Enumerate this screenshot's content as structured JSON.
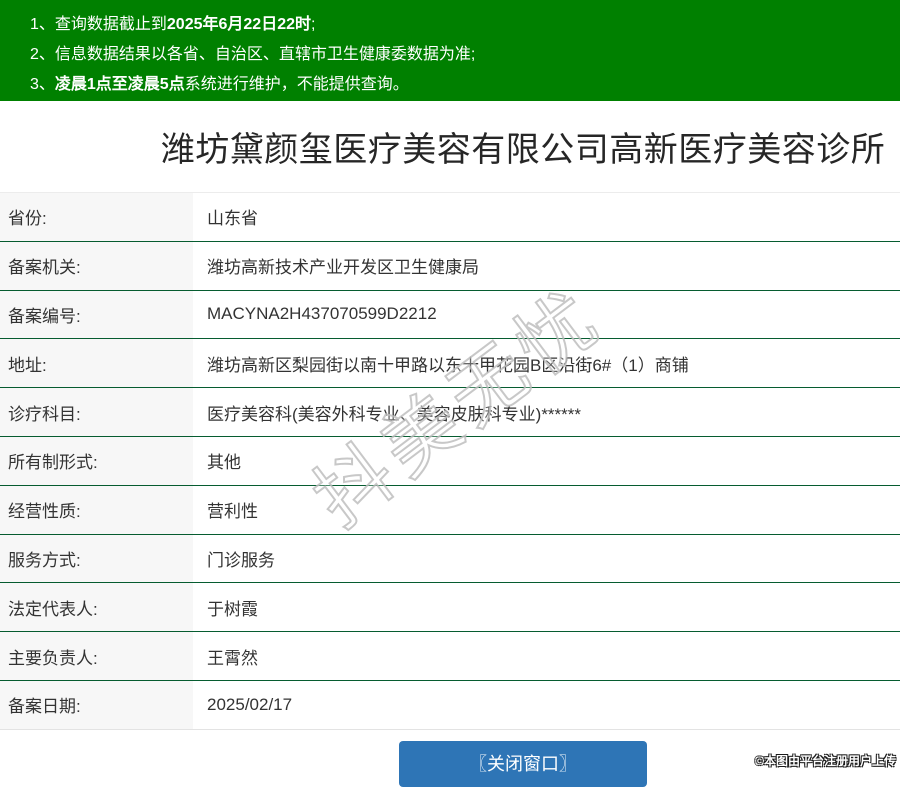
{
  "banner": {
    "bg_color": "#008000",
    "lines": [
      {
        "prefix": "1、查询数据截止到",
        "bold": "2025年6月22日22时",
        "suffix": ";"
      },
      {
        "prefix": "2、信息数据结果以各省、自治区、直辖市卫生健康委数据为准;",
        "bold": "",
        "suffix": ""
      },
      {
        "prefix": "3、",
        "bold": "凌晨1点至凌晨5点",
        "suffix": "系统进行维护，不能提供查询。"
      }
    ]
  },
  "title": "潍坊黛颜玺医疗美容有限公司高新医疗美容诊所",
  "table": {
    "rows": [
      {
        "label": "省份:",
        "value": "山东省"
      },
      {
        "label": "备案机关:",
        "value": "潍坊高新技术产业开发区卫生健康局"
      },
      {
        "label": "备案编号:",
        "value": "MACYNA2H437070599D2212"
      },
      {
        "label": "地址:",
        "value": "潍坊高新区梨园街以南十甲路以东十甲花园B区沿街6#（1）商铺"
      },
      {
        "label": "诊疗科目:",
        "value": "医疗美容科(美容外科专业、美容皮肤科专业)******"
      },
      {
        "label": "所有制形式:",
        "value": "其他"
      },
      {
        "label": "经营性质:",
        "value": "营利性"
      },
      {
        "label": "服务方式:",
        "value": "门诊服务"
      },
      {
        "label": "法定代表人:",
        "value": "于树霞"
      },
      {
        "label": "主要负责人:",
        "value": "王霄然"
      },
      {
        "label": "备案日期:",
        "value": "2025/02/17"
      }
    ]
  },
  "footer": {
    "close_button_label": "〖关闭窗口〗",
    "button_color": "#2e75b6"
  },
  "overlay": {
    "watermark": "抖美无忧",
    "copyright": "©本图由平台注册用户上传"
  },
  "colors": {
    "banner_green": "#008000",
    "separator_green": "#065c30",
    "label_bg": "#f7f7f7",
    "button_blue": "#2e75b6"
  }
}
